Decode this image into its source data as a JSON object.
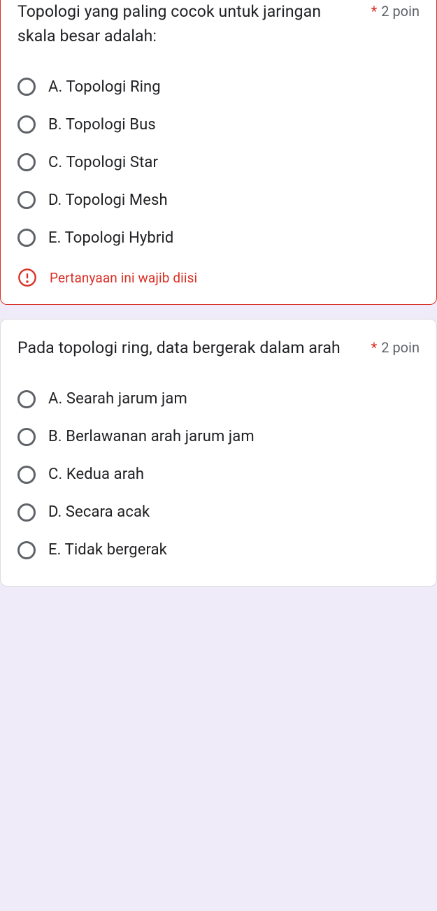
{
  "questions": [
    {
      "text": "Topologi yang paling cocok untuk jaringan skala besar adalah:",
      "required_mark": "*",
      "points": "2 poin",
      "options": [
        "A. Topologi Ring",
        "B. Topologi Bus",
        "C. Topologi Star",
        "D. Topologi Mesh",
        "E. Topologi Hybrid"
      ],
      "error": "Pertanyaan ini wajib diisi"
    },
    {
      "text": "Pada topologi ring, data bergerak dalam arah",
      "required_mark": "*",
      "points": "2 poin",
      "options": [
        "A. Searah jarum jam",
        "B. Berlawanan arah jarum jam",
        "C. Kedua arah",
        "D. Secara acak",
        "E. Tidak bergerak"
      ]
    }
  ]
}
